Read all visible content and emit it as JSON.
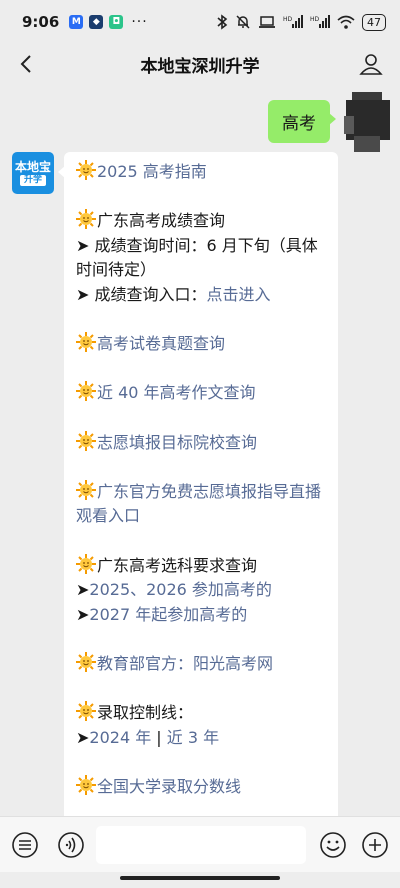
{
  "status_bar": {
    "time": "9:06",
    "dots": "···",
    "battery": "47",
    "icons": [
      "message-app-icon",
      "blue-app-icon",
      "green-app-icon",
      "bluetooth-icon",
      "mute-bell-icon",
      "laptop-icon",
      "signal-icon",
      "signal-icon",
      "wifi-icon",
      "battery-icon"
    ],
    "signal_tag": "HD"
  },
  "nav": {
    "title": "本地宝深圳升学"
  },
  "sent_message": {
    "text": "高考"
  },
  "bot_avatar": {
    "top_text": "本地宝",
    "bottom_text": "升学"
  },
  "message": {
    "guide": "2025 高考指南",
    "score_title": "广东高考成绩查询",
    "score_time_prefix": "➤ 成绩查询时间：6 月下旬（具体时间待定）",
    "score_entry_prefix": "➤ 成绩查询入口：",
    "score_entry_link": "点击进入",
    "papers": "高考试卷真题查询",
    "essays": "近 40 年高考作文查询",
    "colleges": "志愿填报目标院校查询",
    "live_guide": "广东官方免费志愿填报指导直播观看入口",
    "subject_title": "广东高考选科要求查询",
    "subject_arrow_1": "➤",
    "subject_link_1": "2025、2026 参加高考的",
    "subject_arrow_2": "➤",
    "subject_link_2": "2027 年起参加高考的",
    "moe_prefix": "教育部官方：",
    "moe_link": "阳光高考网",
    "control_title": "录取控制线：",
    "control_arrow": "➤",
    "control_link_1": "2024 年",
    "control_sep": " | ",
    "control_link_2": "近 3 年",
    "national_scores": "全国大学录取分数线"
  },
  "colors": {
    "link": "#576b95",
    "bubble_out": "#95ec69",
    "bot_avatar": "#1a8fe0"
  }
}
